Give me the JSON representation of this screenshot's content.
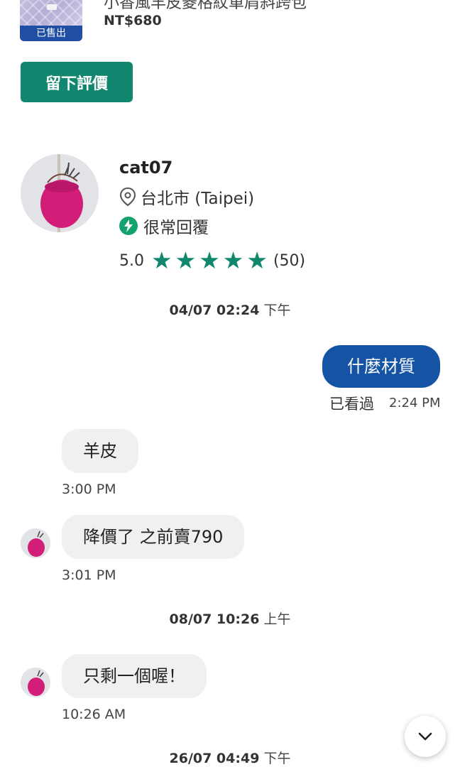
{
  "listing": {
    "title": "小香風羊皮菱格紋單肩斜跨包",
    "price": "NT$680",
    "sold_badge": "已售出"
  },
  "review_button": "留下評價",
  "seller": {
    "name": "cat07",
    "location": "台北市 (Taipei)",
    "response": "很常回覆",
    "rating": "5.0",
    "stars": 5,
    "review_count": "(50)"
  },
  "colors": {
    "accent_green": "#12876f",
    "bubble_blue": "#1553a4",
    "bag_pink": "#d21d79"
  },
  "chat": {
    "sep1": {
      "date": "04/07 02:24",
      "period": "下午"
    },
    "out1": {
      "text": "什麼材質",
      "status": "已看過",
      "time": "2:24 PM"
    },
    "in1": {
      "text": "羊皮",
      "time": "3:00 PM"
    },
    "in2": {
      "text": "降價了 之前賣790",
      "time": "3:01 PM"
    },
    "sep2": {
      "date": "08/07 10:26",
      "period": "上午"
    },
    "in3": {
      "text": "只剩一個喔！",
      "time": "10:26 AM"
    },
    "sep3": {
      "date": "26/07 04:49",
      "period": "下午"
    }
  },
  "icons": {
    "location": "location-pin-icon",
    "response": "lightning-bolt-icon",
    "star": "star-icon",
    "scroll": "chevron-down-icon"
  }
}
